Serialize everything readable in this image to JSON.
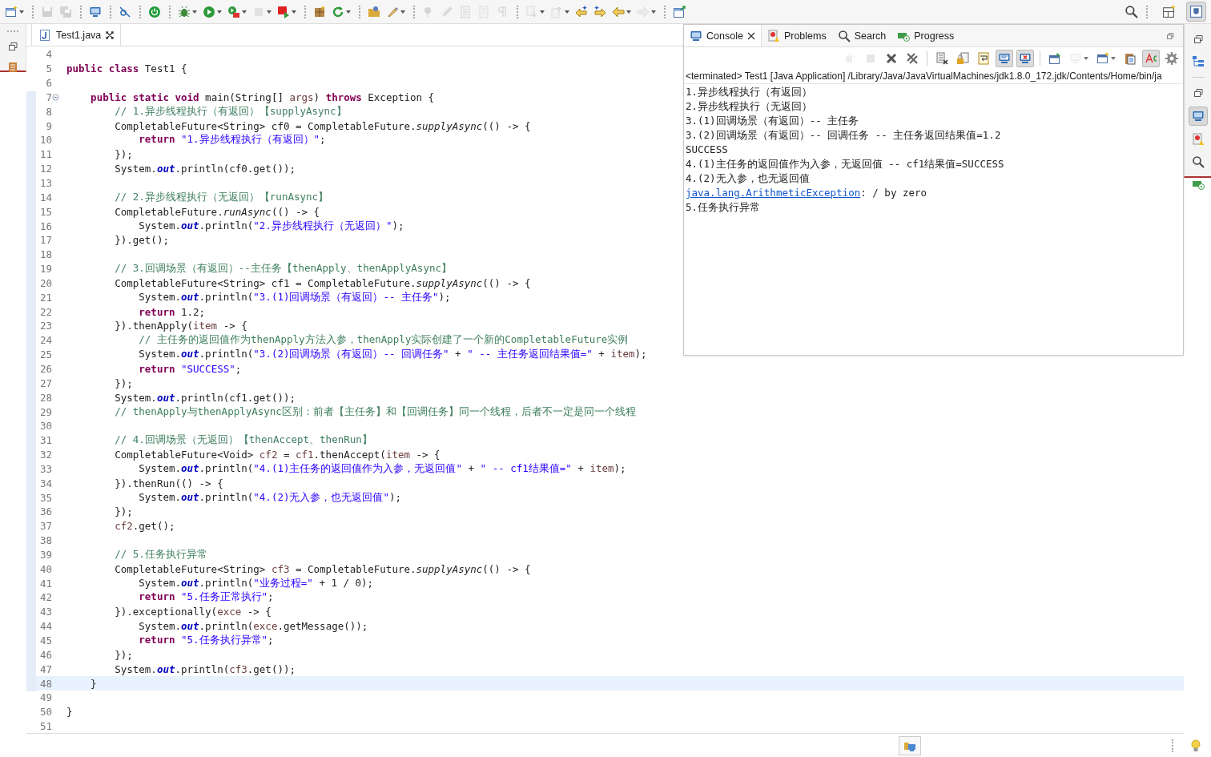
{
  "toolbar": [
    {
      "kind": "new-window",
      "disabled": false,
      "dropdown": true
    },
    {
      "kind": "separator"
    },
    {
      "kind": "save",
      "disabled": true,
      "dropdown": false
    },
    {
      "kind": "save-all",
      "disabled": true,
      "dropdown": false
    },
    {
      "kind": "separator"
    },
    {
      "kind": "monitor",
      "disabled": false,
      "dropdown": false
    },
    {
      "kind": "separator"
    },
    {
      "kind": "skip",
      "disabled": false,
      "dropdown": false
    },
    {
      "kind": "separator"
    },
    {
      "kind": "power",
      "disabled": false,
      "dropdown": false
    },
    {
      "kind": "separator"
    },
    {
      "kind": "bug",
      "disabled": false,
      "dropdown": true
    },
    {
      "kind": "run",
      "disabled": false,
      "dropdown": true
    },
    {
      "kind": "run-tool",
      "disabled": false,
      "dropdown": true
    },
    {
      "kind": "stop",
      "disabled": true,
      "dropdown": true
    },
    {
      "kind": "record",
      "disabled": false,
      "dropdown": true
    },
    {
      "kind": "separator"
    },
    {
      "kind": "package",
      "disabled": false,
      "dropdown": false
    },
    {
      "kind": "refresh",
      "disabled": false,
      "dropdown": true
    },
    {
      "kind": "separator"
    },
    {
      "kind": "folder",
      "disabled": false,
      "dropdown": false
    },
    {
      "kind": "brush",
      "disabled": false,
      "dropdown": true
    },
    {
      "kind": "separator"
    },
    {
      "kind": "pin",
      "disabled": true,
      "dropdown": false
    },
    {
      "kind": "pencil",
      "disabled": true,
      "dropdown": false
    },
    {
      "kind": "doc",
      "disabled": true,
      "dropdown": false
    },
    {
      "kind": "page",
      "disabled": true,
      "dropdown": false
    },
    {
      "kind": "pilcrow",
      "disabled": true,
      "dropdown": false
    },
    {
      "kind": "separator"
    },
    {
      "kind": "down",
      "disabled": true,
      "dropdown": true
    },
    {
      "kind": "up",
      "disabled": true,
      "dropdown": true
    },
    {
      "kind": "back-star",
      "disabled": false,
      "dropdown": false
    },
    {
      "kind": "forward-star",
      "disabled": false,
      "dropdown": false
    },
    {
      "kind": "back",
      "disabled": false,
      "dropdown": true
    },
    {
      "kind": "forward",
      "disabled": true,
      "dropdown": true
    },
    {
      "kind": "separator"
    },
    {
      "kind": "open-perspective",
      "disabled": false,
      "dropdown": false
    }
  ],
  "toolbar_right": [
    {
      "kind": "search",
      "selected": false
    },
    {
      "kind": "perspective",
      "selected": false
    },
    {
      "kind": "java",
      "selected": true
    }
  ],
  "left_trim": [
    {
      "kind": "restore"
    },
    {
      "kind": "explorer"
    }
  ],
  "editor": {
    "tab": {
      "label": "Test1.java",
      "selected": true
    },
    "lines": [
      {
        "number": "4",
        "current": false
      },
      {
        "number": "5",
        "current": false,
        "segments": [
          {
            "kind": "keyword",
            "text": "public class"
          },
          {
            "kind": "plain",
            "text": " Test1 {"
          }
        ]
      },
      {
        "number": "6",
        "current": false
      },
      {
        "number": "7",
        "current": false,
        "fold": true,
        "segments": [
          {
            "kind": "keyword",
            "text": "    public static void"
          },
          {
            "kind": "plain",
            "text": " main(String[] "
          },
          {
            "kind": "variable",
            "text": "args"
          },
          {
            "kind": "plain",
            "text": ") "
          },
          {
            "kind": "keyword",
            "text": "throws"
          },
          {
            "kind": "plain",
            "text": " Exception {"
          }
        ]
      },
      {
        "number": "8",
        "current": false,
        "segments": [
          {
            "kind": "comment",
            "text": "        // 1.异步线程执行（有返回）【supplyAsync】"
          }
        ]
      },
      {
        "number": "9",
        "current": false,
        "segments": [
          {
            "kind": "plain",
            "text": "        CompletableFuture<String> cf0 = CompletableFuture."
          },
          {
            "kind": "static",
            "text": "supplyAsync"
          },
          {
            "kind": "plain",
            "text": "(() -> {"
          }
        ]
      },
      {
        "number": "10",
        "current": false,
        "segments": [
          {
            "kind": "keyword",
            "text": "            return "
          },
          {
            "kind": "string",
            "text": "\"1.异步线程执行（有返回）\""
          },
          {
            "kind": "plain",
            "text": ";"
          }
        ]
      },
      {
        "number": "11",
        "current": false,
        "segments": [
          {
            "kind": "plain",
            "text": "        });"
          }
        ]
      },
      {
        "number": "12",
        "current": false,
        "segments": [
          {
            "kind": "plain",
            "text": "        System."
          },
          {
            "kind": "field",
            "text": "out"
          },
          {
            "kind": "plain",
            "text": ".println(cf0.get());"
          }
        ]
      },
      {
        "number": "13",
        "current": false
      },
      {
        "number": "14",
        "current": false,
        "segments": [
          {
            "kind": "comment",
            "text": "        // 2.异步线程执行（无返回）【runAsync】"
          }
        ]
      },
      {
        "number": "15",
        "current": false,
        "segments": [
          {
            "kind": "plain",
            "text": "        CompletableFuture."
          },
          {
            "kind": "static",
            "text": "runAsync"
          },
          {
            "kind": "plain",
            "text": "(() -> {"
          }
        ]
      },
      {
        "number": "16",
        "current": false,
        "segments": [
          {
            "kind": "plain",
            "text": "            System."
          },
          {
            "kind": "field",
            "text": "out"
          },
          {
            "kind": "plain",
            "text": ".println("
          },
          {
            "kind": "string",
            "text": "\"2.异步线程执行（无返回）\""
          },
          {
            "kind": "plain",
            "text": ");"
          }
        ]
      },
      {
        "number": "17",
        "current": false,
        "segments": [
          {
            "kind": "plain",
            "text": "        }).get();"
          }
        ]
      },
      {
        "number": "18",
        "current": false
      },
      {
        "number": "19",
        "current": false,
        "segments": [
          {
            "kind": "comment",
            "text": "        // 3.回调场景（有返回）--主任务【thenApply、thenApplyAsync】"
          }
        ]
      },
      {
        "number": "20",
        "current": false,
        "segments": [
          {
            "kind": "plain",
            "text": "        CompletableFuture<String> cf1 = CompletableFuture."
          },
          {
            "kind": "static",
            "text": "supplyAsync"
          },
          {
            "kind": "plain",
            "text": "(() -> {"
          }
        ]
      },
      {
        "number": "21",
        "current": false,
        "segments": [
          {
            "kind": "plain",
            "text": "            System."
          },
          {
            "kind": "field",
            "text": "out"
          },
          {
            "kind": "plain",
            "text": ".println("
          },
          {
            "kind": "string",
            "text": "\"3.(1)回调场景（有返回）-- 主任务\""
          },
          {
            "kind": "plain",
            "text": ");"
          }
        ]
      },
      {
        "number": "22",
        "current": false,
        "segments": [
          {
            "kind": "keyword",
            "text": "            return"
          },
          {
            "kind": "plain",
            "text": " 1.2;"
          }
        ]
      },
      {
        "number": "23",
        "current": false,
        "segments": [
          {
            "kind": "plain",
            "text": "        }).thenApply("
          },
          {
            "kind": "variable",
            "text": "item"
          },
          {
            "kind": "plain",
            "text": " -> {"
          }
        ]
      },
      {
        "number": "24",
        "current": false,
        "segments": [
          {
            "kind": "comment",
            "text": "            // 主任务的返回值作为thenApply方法入参，thenApply实际创建了一个新的CompletableFuture实例"
          }
        ]
      },
      {
        "number": "25",
        "current": false,
        "segments": [
          {
            "kind": "plain",
            "text": "            System."
          },
          {
            "kind": "field",
            "text": "out"
          },
          {
            "kind": "plain",
            "text": ".println("
          },
          {
            "kind": "string",
            "text": "\"3.(2)回调场景（有返回）-- 回调任务\""
          },
          {
            "kind": "plain",
            "text": " + "
          },
          {
            "kind": "string",
            "text": "\" -- 主任务返回结果值=\""
          },
          {
            "kind": "plain",
            "text": " + "
          },
          {
            "kind": "variable",
            "text": "item"
          },
          {
            "kind": "plain",
            "text": ");"
          }
        ]
      },
      {
        "number": "26",
        "current": false,
        "segments": [
          {
            "kind": "keyword",
            "text": "            return "
          },
          {
            "kind": "string",
            "text": "\"SUCCESS\""
          },
          {
            "kind": "plain",
            "text": ";"
          }
        ]
      },
      {
        "number": "27",
        "current": false,
        "segments": [
          {
            "kind": "plain",
            "text": "        });"
          }
        ]
      },
      {
        "number": "28",
        "current": false,
        "segments": [
          {
            "kind": "plain",
            "text": "        System."
          },
          {
            "kind": "field",
            "text": "out"
          },
          {
            "kind": "plain",
            "text": ".println(cf1.get());"
          }
        ]
      },
      {
        "number": "29",
        "current": false,
        "segments": [
          {
            "kind": "comment",
            "text": "        // thenApply与thenApplyAsync区别：前者【主任务】和【回调任务】同一个线程，后者不一定是同一个线程"
          }
        ]
      },
      {
        "number": "30",
        "current": false
      },
      {
        "number": "31",
        "current": false,
        "segments": [
          {
            "kind": "comment",
            "text": "        // 4.回调场景（无返回）【thenAccept、thenRun】"
          }
        ]
      },
      {
        "number": "32",
        "current": false,
        "segments": [
          {
            "kind": "plain",
            "text": "        CompletableFuture<Void> "
          },
          {
            "kind": "variable",
            "text": "cf2"
          },
          {
            "kind": "plain",
            "text": " = "
          },
          {
            "kind": "variable",
            "text": "cf1"
          },
          {
            "kind": "plain",
            "text": ".thenAccept("
          },
          {
            "kind": "variable",
            "text": "item"
          },
          {
            "kind": "plain",
            "text": " -> {"
          }
        ]
      },
      {
        "number": "33",
        "current": false,
        "segments": [
          {
            "kind": "plain",
            "text": "            System."
          },
          {
            "kind": "field",
            "text": "out"
          },
          {
            "kind": "plain",
            "text": ".println("
          },
          {
            "kind": "string",
            "text": "\"4.(1)主任务的返回值作为入参，无返回值\""
          },
          {
            "kind": "plain",
            "text": " + "
          },
          {
            "kind": "string",
            "text": "\" -- cf1结果值=\""
          },
          {
            "kind": "plain",
            "text": " + "
          },
          {
            "kind": "variable",
            "text": "item"
          },
          {
            "kind": "plain",
            "text": ");"
          }
        ]
      },
      {
        "number": "34",
        "current": false,
        "segments": [
          {
            "kind": "plain",
            "text": "        }).thenRun(() -> {"
          }
        ]
      },
      {
        "number": "35",
        "current": false,
        "segments": [
          {
            "kind": "plain",
            "text": "            System."
          },
          {
            "kind": "field",
            "text": "out"
          },
          {
            "kind": "plain",
            "text": ".println("
          },
          {
            "kind": "string",
            "text": "\"4.(2)无入参，也无返回值\""
          },
          {
            "kind": "plain",
            "text": ");"
          }
        ]
      },
      {
        "number": "36",
        "current": false,
        "segments": [
          {
            "kind": "plain",
            "text": "        });"
          }
        ]
      },
      {
        "number": "37",
        "current": false,
        "segments": [
          {
            "kind": "variable",
            "text": "        cf2"
          },
          {
            "kind": "plain",
            "text": ".get();"
          }
        ]
      },
      {
        "number": "38",
        "current": false
      },
      {
        "number": "39",
        "current": false,
        "segments": [
          {
            "kind": "comment",
            "text": "        // 5.任务执行异常"
          }
        ]
      },
      {
        "number": "40",
        "current": false,
        "segments": [
          {
            "kind": "plain",
            "text": "        CompletableFuture<String> "
          },
          {
            "kind": "variable",
            "text": "cf3"
          },
          {
            "kind": "plain",
            "text": " = CompletableFuture."
          },
          {
            "kind": "static",
            "text": "supplyAsync"
          },
          {
            "kind": "plain",
            "text": "(() -> {"
          }
        ]
      },
      {
        "number": "41",
        "current": false,
        "segments": [
          {
            "kind": "plain",
            "text": "            System."
          },
          {
            "kind": "field",
            "text": "out"
          },
          {
            "kind": "plain",
            "text": ".println("
          },
          {
            "kind": "string",
            "text": "\"业务过程=\""
          },
          {
            "kind": "plain",
            "text": " + 1 / 0);"
          }
        ]
      },
      {
        "number": "42",
        "current": false,
        "segments": [
          {
            "kind": "keyword",
            "text": "            return "
          },
          {
            "kind": "string",
            "text": "\"5.任务正常执行\""
          },
          {
            "kind": "plain",
            "text": ";"
          }
        ]
      },
      {
        "number": "43",
        "current": false,
        "segments": [
          {
            "kind": "plain",
            "text": "        }).exceptionally("
          },
          {
            "kind": "variable",
            "text": "exce"
          },
          {
            "kind": "plain",
            "text": " -> {"
          }
        ]
      },
      {
        "number": "44",
        "current": false,
        "segments": [
          {
            "kind": "plain",
            "text": "            System."
          },
          {
            "kind": "field",
            "text": "out"
          },
          {
            "kind": "plain",
            "text": ".println("
          },
          {
            "kind": "variable",
            "text": "exce"
          },
          {
            "kind": "plain",
            "text": ".getMessage());"
          }
        ]
      },
      {
        "number": "45",
        "current": false,
        "segments": [
          {
            "kind": "keyword",
            "text": "            return "
          },
          {
            "kind": "string",
            "text": "\"5.任务执行异常\""
          },
          {
            "kind": "plain",
            "text": ";"
          }
        ]
      },
      {
        "number": "46",
        "current": false,
        "segments": [
          {
            "kind": "plain",
            "text": "        });"
          }
        ]
      },
      {
        "number": "47",
        "current": false,
        "segments": [
          {
            "kind": "plain",
            "text": "        System."
          },
          {
            "kind": "field",
            "text": "out"
          },
          {
            "kind": "plain",
            "text": ".println("
          },
          {
            "kind": "variable",
            "text": "cf3"
          },
          {
            "kind": "plain",
            "text": ".get());"
          }
        ]
      },
      {
        "number": "48",
        "current": true,
        "segments": [
          {
            "kind": "plain",
            "text": "    }"
          }
        ]
      },
      {
        "number": "49",
        "current": false
      },
      {
        "number": "50",
        "current": false,
        "segments": [
          {
            "kind": "plain",
            "text": "}"
          }
        ]
      },
      {
        "number": "51",
        "current": false
      }
    ]
  },
  "console": {
    "tabs": [
      {
        "kind": "console",
        "label": "Console",
        "selected": true
      },
      {
        "kind": "problems",
        "label": "Problems",
        "selected": false
      },
      {
        "kind": "search",
        "label": "Search",
        "selected": false
      },
      {
        "kind": "progress",
        "label": "Progress",
        "selected": false
      }
    ],
    "toolbar": [
      {
        "kind": "relaunch",
        "disabled": true,
        "pressed": false,
        "dropdown": false
      },
      {
        "kind": "stop",
        "disabled": true,
        "pressed": false,
        "dropdown": false
      },
      {
        "kind": "remove",
        "disabled": false,
        "pressed": false,
        "dropdown": false
      },
      {
        "kind": "remove-all",
        "disabled": false,
        "pressed": false,
        "dropdown": false
      },
      {
        "kind": "separator"
      },
      {
        "kind": "clear",
        "disabled": false,
        "pressed": false,
        "dropdown": false
      },
      {
        "kind": "lock",
        "disabled": false,
        "pressed": false,
        "dropdown": false
      },
      {
        "kind": "wrap",
        "disabled": false,
        "pressed": false,
        "dropdown": false
      },
      {
        "kind": "show-out",
        "disabled": false,
        "pressed": true,
        "dropdown": false
      },
      {
        "kind": "show-err",
        "disabled": false,
        "pressed": true,
        "dropdown": false
      },
      {
        "kind": "separator"
      },
      {
        "kind": "pin-console",
        "disabled": false,
        "pressed": false,
        "dropdown": false
      },
      {
        "kind": "display",
        "disabled": true,
        "pressed": false,
        "dropdown": true
      },
      {
        "kind": "open-console",
        "disabled": false,
        "pressed": false,
        "dropdown": true
      },
      {
        "kind": "copy",
        "disabled": false,
        "pressed": false,
        "dropdown": false
      },
      {
        "kind": "highlight",
        "disabled": false,
        "pressed": true,
        "dropdown": false
      },
      {
        "kind": "gear",
        "disabled": false,
        "pressed": false,
        "dropdown": false
      }
    ],
    "status": "<terminated> Test1 [Java Application] /Library/Java/JavaVirtualMachines/jdk1.8.0_172.jdk/Contents/Home/bin/ja",
    "output": [
      {
        "text": "1.异步线程执行（有返回）"
      },
      {
        "text": "2.异步线程执行（无返回）"
      },
      {
        "text": "3.(1)回调场景（有返回）-- 主任务"
      },
      {
        "text": "3.(2)回调场景（有返回）-- 回调任务 -- 主任务返回结果值=1.2"
      },
      {
        "text": "SUCCESS"
      },
      {
        "text": "4.(1)主任务的返回值作为入参，无返回值 -- cf1结果值=SUCCESS"
      },
      {
        "text": "4.(2)无入参，也无返回值"
      },
      {
        "link": "java.lang.ArithmeticException",
        "text": ": / by zero"
      },
      {
        "text": "5.任务执行异常"
      }
    ]
  },
  "right_trim": [
    {
      "kind": "restore",
      "selected": false
    },
    {
      "kind": "outline",
      "selected": false
    },
    {
      "kind": "separator"
    },
    {
      "kind": "restore",
      "selected": false
    },
    {
      "kind": "console",
      "selected": true
    },
    {
      "kind": "problems",
      "selected": false
    },
    {
      "kind": "search",
      "selected": false
    },
    {
      "kind": "progress",
      "selected": false
    }
  ],
  "status_bar": [
    {
      "kind": "notification"
    },
    {
      "kind": "separator"
    },
    {
      "kind": "tip"
    }
  ]
}
